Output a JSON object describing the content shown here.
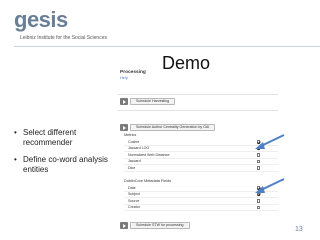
{
  "logo": {
    "word": "gesis",
    "subtitle": "Leibniz Institute for the Social Sciences"
  },
  "slide": {
    "title": "Demo",
    "page_number": "13"
  },
  "bullets": [
    "Select different recommender",
    "Define co-word analysis entities"
  ],
  "panel": {
    "title": "Processing",
    "link": "Help",
    "buttons": {
      "schedule_harvesting": "Schedule Harvesting",
      "schedule_author": "Schedule Author Centrality Generation by OAI",
      "schedule_stw": "Schedule STW for processing"
    },
    "metrics": {
      "label": "Metrics",
      "items": [
        {
          "label": "Cosine",
          "checked": true
        },
        {
          "label": "Jaccard LOG",
          "checked": true
        },
        {
          "label": "Normalized Web Distance",
          "checked": false
        },
        {
          "label": "Jaccard",
          "checked": false
        },
        {
          "label": "Dice",
          "checked": false
        }
      ]
    },
    "fields": {
      "label": "DublinCore Metadata Fields",
      "items": [
        {
          "label": "Date",
          "checked": true
        },
        {
          "label": "Subject",
          "checked": true
        },
        {
          "label": "Source",
          "checked": false
        },
        {
          "label": "Creator",
          "checked": false
        }
      ]
    }
  },
  "colors": {
    "logo": "#6a7f95",
    "arrow": "#4f7fc6",
    "link": "#4a7bc7"
  }
}
